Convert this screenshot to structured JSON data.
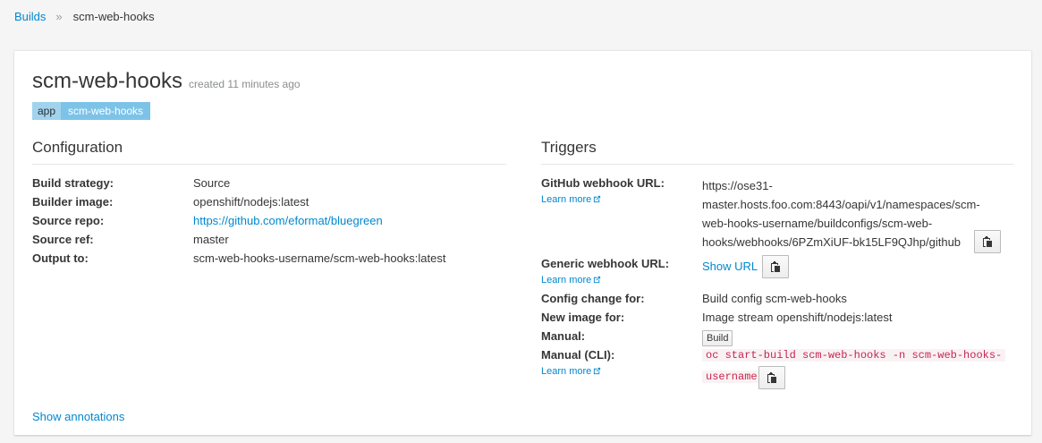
{
  "breadcrumb": {
    "root": "Builds",
    "separator": "»",
    "current": "scm-web-hooks"
  },
  "header": {
    "title": "scm-web-hooks",
    "subtitle": "created 11 minutes ago"
  },
  "labels": [
    {
      "key": "app",
      "value": "scm-web-hooks"
    }
  ],
  "configuration": {
    "title": "Configuration",
    "rows": [
      {
        "label": "Build strategy:",
        "value": "Source"
      },
      {
        "label": "Builder image:",
        "value": "openshift/nodejs:latest"
      },
      {
        "label": "Source repo:",
        "value": "https://github.com/eformat/bluegreen"
      },
      {
        "label": "Source ref:",
        "value": "master"
      },
      {
        "label": "Output to:",
        "value": "scm-web-hooks-username/scm-web-hooks:latest"
      }
    ]
  },
  "triggers": {
    "title": "Triggers",
    "learn_more": "Learn more",
    "github": {
      "label": "GitHub webhook URL:",
      "url_lines": [
        "https://ose31-",
        "master.hosts.foo.com:8443/oapi/v1/namespaces/scm-",
        "web-hooks-username/buildconfigs/scm-web-",
        "hooks/webhooks/6PZmXiUF-bk15LF9QJhp/github"
      ]
    },
    "generic": {
      "label": "Generic webhook URL:",
      "show_url": "Show URL"
    },
    "config_change": {
      "label": "Config change for:",
      "value": "Build config scm-web-hooks"
    },
    "new_image": {
      "label": "New image for:",
      "value": "Image stream openshift/nodejs:latest"
    },
    "manual": {
      "label": "Manual:",
      "button": "Build"
    },
    "manual_cli": {
      "label": "Manual (CLI):",
      "command_lines": [
        "oc start-build scm-web-hooks -n scm-web-hooks-",
        "username"
      ]
    }
  },
  "footer": {
    "show_annotations": "Show annotations"
  },
  "colors": {
    "link": "#0088ce",
    "label_key_bg": "#a1d3ed",
    "label_val_bg": "#7dc3e8",
    "code_text": "#c7254e"
  },
  "icons": {
    "external_link": "external-link-icon",
    "copy": "clipboard-icon"
  }
}
